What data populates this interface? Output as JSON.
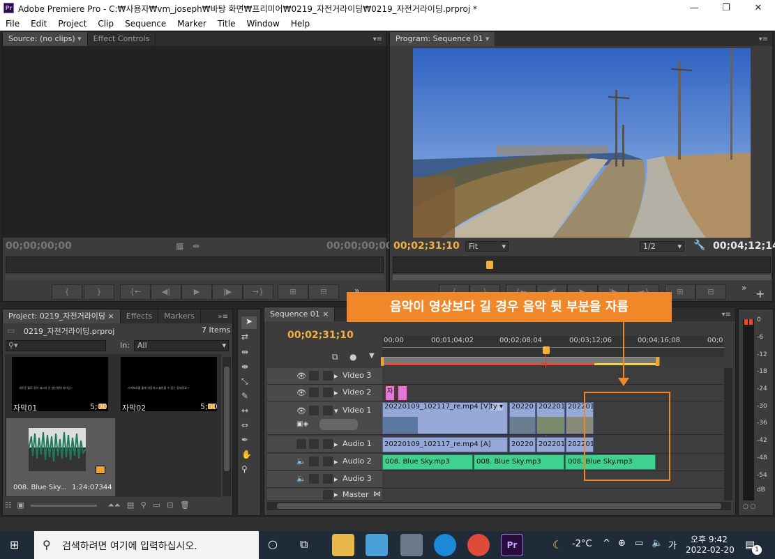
{
  "window": {
    "title": "Adobe Premiere Pro - C:₩사용자₩vm_joseph₩바탕 화면₩프리미어₩0219_자전거라이딩₩0219_자전거라이딩.prproj *"
  },
  "menu": [
    "File",
    "Edit",
    "Project",
    "Clip",
    "Sequence",
    "Marker",
    "Title",
    "Window",
    "Help"
  ],
  "source": {
    "tab": "Source: (no clips)",
    "tab2": "Effect Controls",
    "tc_left": "00;00;00;00",
    "tc_right": "00;00;00;00"
  },
  "program": {
    "tab": "Program: Sequence 01",
    "tc_left": "00;02;31;10",
    "fit": "Fit",
    "res": "1/2",
    "tc_right": "00;04;12;14"
  },
  "project": {
    "tabs": [
      "Project: 0219_자전거라이딩",
      "Effects",
      "Markers"
    ],
    "file": "0219_자전거라이딩.prproj",
    "count": "7 Items",
    "in_label": "In:",
    "in_value": "All",
    "items": [
      {
        "name": "자막01",
        "dur": "5;00",
        "caption": "새로운 활로 찾아 내고자 산 왕선설해 과타임~"
      },
      {
        "name": "자막02",
        "dur": "5;00",
        "caption": "스케프로를 출에 지동하고 뿔반을 수 있는 장재귀요~"
      },
      {
        "name": "008. Blue Sky...",
        "dur": "1:24:07344"
      }
    ]
  },
  "sequence": {
    "tab": "Sequence 01",
    "timecode": "00;02;31;10",
    "ruler": [
      "00;00",
      "00;01;04;02",
      "00;02;08;04",
      "00;03;12;06",
      "00;04;16;08",
      "00;0"
    ],
    "tracks": {
      "v3": "Video 3",
      "v2": "Video 2",
      "v1": "Video 1",
      "a1": "Audio 1",
      "a2": "Audio 2",
      "a3": "Audio 3",
      "master": "Master"
    },
    "v1_clips": [
      "20220109_102117_re.mp4 [V]",
      "ty ▾",
      "20220",
      "2022010",
      "202201"
    ],
    "a1_clips": [
      "20220109_102117_re.mp4 [A]",
      "20220",
      "2022010",
      "202201"
    ],
    "a2_clips": [
      "008. Blue Sky.mp3",
      "008. Blue Sky.mp3",
      "008. Blue Sky.mp3"
    ],
    "v2_clip_label": "자"
  },
  "annotation": {
    "text": "음악이 영상보다 길 경우 음악 뒷 부분을 자름",
    "bg": "#f0882a"
  },
  "meter": {
    "labels": [
      "0",
      "-6",
      "-12",
      "-18",
      "-24",
      "-30",
      "-36",
      "-42",
      "-48",
      "-54",
      "dB"
    ]
  },
  "taskbar": {
    "search": "검색하려면 여기에 입력하십시오.",
    "weather": "-2°C",
    "ime": "가",
    "time": "오후 9:42",
    "date": "2022-02-20",
    "notif": "1"
  }
}
